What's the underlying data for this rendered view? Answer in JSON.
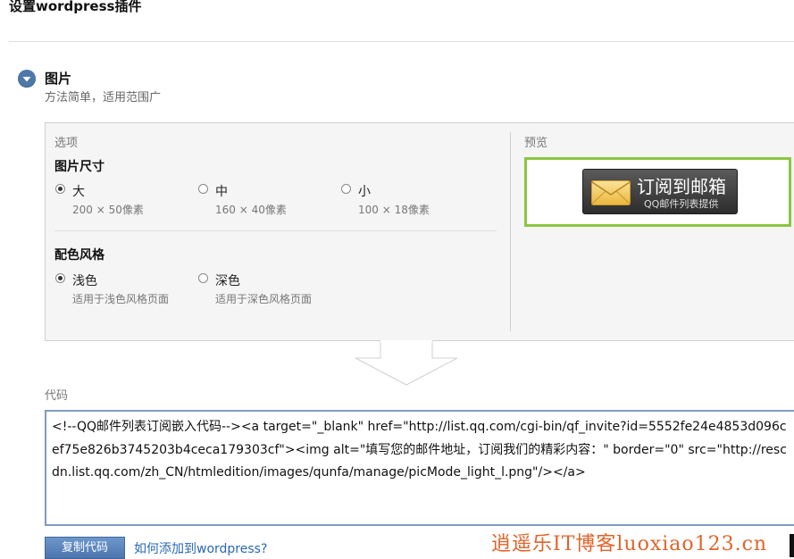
{
  "page": {
    "title": "设置wordpress插件"
  },
  "section": {
    "title": "图片",
    "subtitle": "方法简单，适用范围广",
    "toggle_icon": "chevron-down-icon"
  },
  "options": {
    "label": "选项",
    "size_group": {
      "title": "图片尺寸",
      "selected": "大",
      "items": [
        {
          "label": "大",
          "desc": "200 × 50像素",
          "checked": true
        },
        {
          "label": "中",
          "desc": "160 × 40像素",
          "checked": false
        },
        {
          "label": "小",
          "desc": "100 × 18像素",
          "checked": false
        }
      ]
    },
    "color_group": {
      "title": "配色风格",
      "selected": "浅色",
      "items": [
        {
          "label": "浅色",
          "desc": "适用于浅色风格页面",
          "checked": true
        },
        {
          "label": "深色",
          "desc": "适用于深色风格页面",
          "checked": false
        }
      ]
    }
  },
  "preview": {
    "label": "预览",
    "badge_main": "订阅到邮箱",
    "badge_sub": "QQ邮件列表提供",
    "badge_icon": "envelope-icon",
    "highlight_color": "#8cc63f"
  },
  "arrow_icon": "down-arrow-icon",
  "code": {
    "label": "代码",
    "value": "<!--QQ邮件列表订阅嵌入代码--><a target=\"_blank\" href=\"http://list.qq.com/cgi-bin/qf_invite?id=5552fe24e4853d096cef75e826b3745203b4ceca179303cf\"><img alt=\"填写您的邮件地址，订阅我们的精彩内容：\" border=\"0\" src=\"http://rescdn.list.qq.com/zh_CN/htmledition/images/qunfa/manage/picMode_light_l.png\"/></a>"
  },
  "actions": {
    "copy_label": "复制代码",
    "help_link": "如何添加到wordpress?"
  },
  "watermark": "逍遥乐IT博客luoxiao123.cn",
  "colors": {
    "accent": "#4e78a8",
    "link": "#2a67b6",
    "button": "#5a86bd",
    "watermark": "#e0642a"
  }
}
